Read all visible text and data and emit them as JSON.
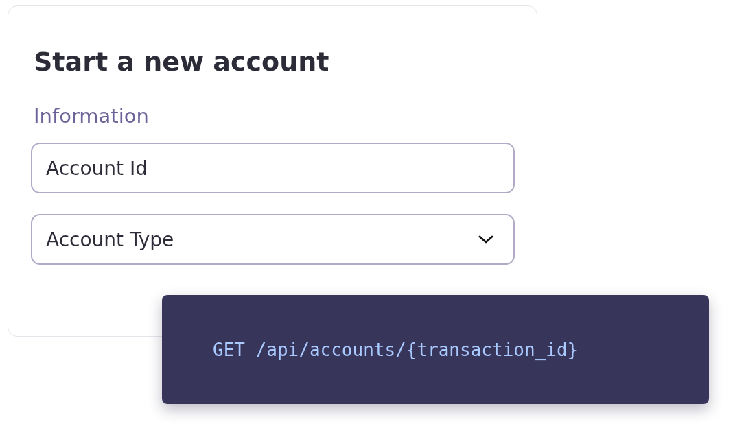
{
  "card": {
    "title": "Start a new account",
    "section_label": "Information",
    "fields": [
      {
        "kind": "text",
        "placeholder": "Account Id"
      },
      {
        "kind": "select",
        "placeholder": "Account Type"
      }
    ]
  },
  "code_snippet": {
    "text": "GET /api/accounts/{transaction_id}"
  }
}
